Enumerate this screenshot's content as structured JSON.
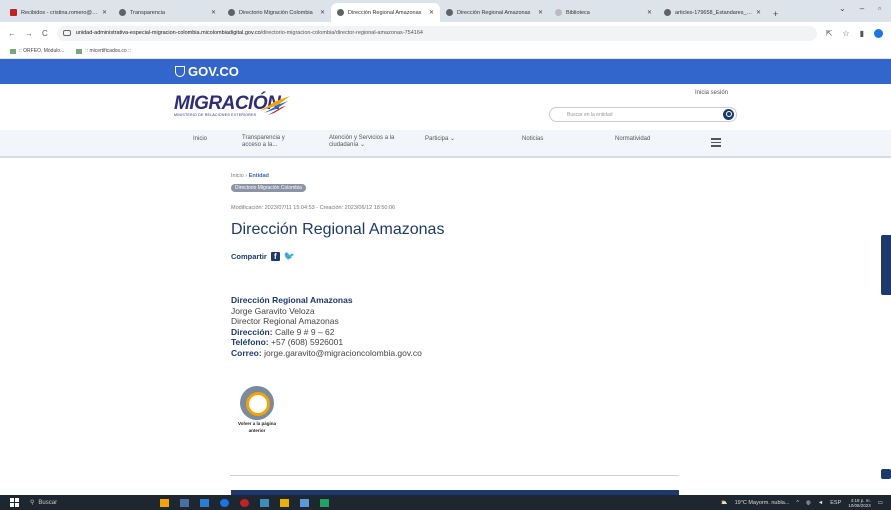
{
  "browser": {
    "tabs": [
      {
        "label": "Recibidos - cristina.romero@m..."
      },
      {
        "label": "Transparencia"
      },
      {
        "label": "Directorio Migración Colombia"
      },
      {
        "label": "Dirección Regional Amazonas"
      },
      {
        "label": "Dirección Regional Amazonas"
      },
      {
        "label": "Biblioteca"
      },
      {
        "label": "articles-179658_Estandares_m..."
      }
    ],
    "url_domain": "unidad-administrativa-especial-migracion-colombia.micolombiadigital.gov.co",
    "url_path": "/directorio-migracion-colombia/director-regional-amazonas-754164",
    "bookmarks": [
      ":: ORFEO, Módulo...",
      ":: micertificados.co ::"
    ]
  },
  "gov": {
    "label": "GOV.CO"
  },
  "header": {
    "logo_word": "MIGRACIÓN",
    "logo_sub": "MINISTERIO DE RELACIONES EXTERIORES",
    "login": "Inicia sesión",
    "search_placeholder": "Buscar en la entidad"
  },
  "nav": {
    "items": [
      "Inicio",
      "Transparencia y",
      "acceso a la...",
      "Atención y Servicios a la",
      "ciudadanía ⌄",
      "Participa ⌄",
      "Noticias",
      "Normatividad"
    ]
  },
  "page": {
    "crumb_home": "Inicio",
    "crumb_sep": "›",
    "crumb_current": "Entidad",
    "pill": "Directorio Migración Colombia",
    "meta": "Modificación: 2023/07/11 15:04:53 - Creación: 2023/06/12 18:50:06",
    "title": "Dirección Regional Amazonas",
    "share": "Compartir",
    "contact": {
      "office": "Dirección Regional Amazonas",
      "name": "Jorge Garavito Veloza",
      "role": "Director Regional Amazonas",
      "address_label": "Dirección:",
      "address": "Calle 9 # 9 – 62",
      "phone_label": "Teléfono:",
      "phone": "+57 (608) 5926001",
      "email_label": "Correo:",
      "email": "jorge.garavito@migracioncolombia.gov.co"
    },
    "back_line1": "Volver a la página",
    "back_line2": "anterior"
  },
  "taskbar": {
    "search": "Buscar",
    "weather": "19°C Mayorm. nubla...",
    "lang": "ESP",
    "time": "4:18 p. m.",
    "date": "10/08/2023"
  }
}
